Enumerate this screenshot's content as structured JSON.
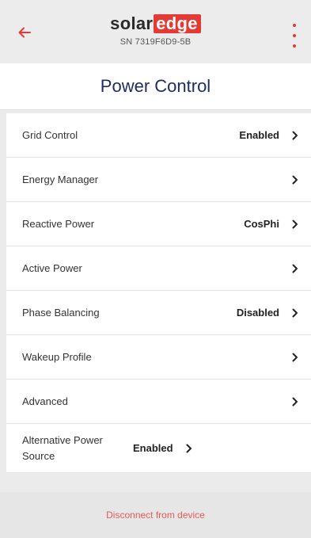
{
  "header": {
    "back_icon": "arrow-left-icon",
    "brand": {
      "part1": "solar",
      "part2": "edge"
    },
    "serial": "SN 7319F6D9-5B",
    "menu_icon": "more-vertical-icon",
    "accent_color": "#e53935"
  },
  "title": "Power Control",
  "items": [
    {
      "label": "Grid Control",
      "value": "Enabled"
    },
    {
      "label": "Energy Manager",
      "value": ""
    },
    {
      "label": "Reactive Power",
      "value": "CosPhi"
    },
    {
      "label": "Active Power",
      "value": ""
    },
    {
      "label": "Phase Balancing",
      "value": "Disabled"
    },
    {
      "label": "Wakeup Profile",
      "value": ""
    },
    {
      "label": "Advanced",
      "value": ""
    },
    {
      "label": "Alternative Power Source",
      "value": "Enabled"
    }
  ],
  "footer": {
    "disconnect_label": "Disconnect from device"
  }
}
